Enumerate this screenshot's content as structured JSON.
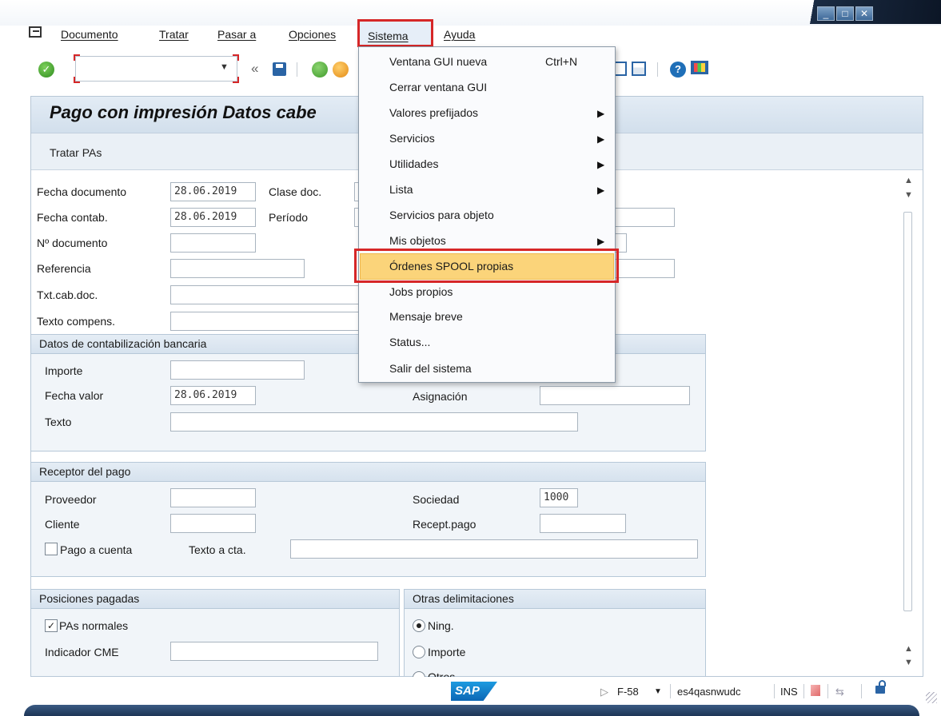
{
  "menubar": {
    "items": [
      "Documento",
      "Tratar",
      "Pasar a",
      "Opciones",
      "Sistema",
      "Ayuda"
    ]
  },
  "toolbar": {
    "back_glyph": "«"
  },
  "title": "Pago con impresión Datos cabe",
  "app_toolbar": {
    "button": "Tratar PAs"
  },
  "header_fields": {
    "fecha_documento": {
      "label": "Fecha documento",
      "value": "28.06.2019"
    },
    "clase_doc": {
      "label": "Clase doc.",
      "value": ""
    },
    "fecha_contab": {
      "label": "Fecha contab.",
      "value": "28.06.2019"
    },
    "periodo": {
      "label": "Período",
      "value": ""
    },
    "no_documento": {
      "label": "Nº documento",
      "value": ""
    },
    "referencia": {
      "label": "Referencia",
      "value": ""
    },
    "txt_cab_doc": {
      "label": "Txt.cab.doc.",
      "value": ""
    },
    "texto_compens": {
      "label": "Texto compens.",
      "value": ""
    }
  },
  "bank_group": {
    "title": "Datos de contabilización bancaria",
    "importe": {
      "label": "Importe",
      "value": ""
    },
    "fecha_valor": {
      "label": "Fecha valor",
      "value": "28.06.2019"
    },
    "asignacion": {
      "label": "Asignación",
      "value": ""
    },
    "texto": {
      "label": "Texto",
      "value": ""
    }
  },
  "payee_group": {
    "title": "Receptor del pago",
    "proveedor": {
      "label": "Proveedor",
      "value": ""
    },
    "sociedad": {
      "label": "Sociedad",
      "value": "1000"
    },
    "cliente": {
      "label": "Cliente",
      "value": ""
    },
    "recept_pago": {
      "label": "Recept.pago",
      "value": ""
    },
    "pago_a_cuenta": {
      "label": "Pago a cuenta",
      "checked": false
    },
    "texto_a_cta": {
      "label": "Texto a cta.",
      "value": ""
    }
  },
  "paid_items_group": {
    "title": "Posiciones pagadas",
    "pas_normales": {
      "label": "PAs normales",
      "checked": true
    },
    "indicador_cme": {
      "label": "Indicador CME",
      "value": ""
    }
  },
  "other_group": {
    "title": "Otras delimitaciones",
    "options": [
      "Ning.",
      "Importe",
      "Otros"
    ],
    "selected": "Ning."
  },
  "sistema_menu": {
    "items": [
      {
        "label": "Ventana GUI nueva",
        "shortcut": "Ctrl+N",
        "submenu": false
      },
      {
        "label": "Cerrar ventana GUI",
        "submenu": false
      },
      {
        "label": "Valores prefijados",
        "submenu": true
      },
      {
        "label": "Servicios",
        "submenu": true
      },
      {
        "label": "Utilidades",
        "submenu": true
      },
      {
        "label": "Lista",
        "submenu": true
      },
      {
        "label": "Servicios para objeto",
        "submenu": false
      },
      {
        "label": "Mis objetos",
        "submenu": true
      },
      {
        "label": "Órdenes SPOOL propias",
        "submenu": false,
        "highlighted": true
      },
      {
        "label": "Jobs propios",
        "submenu": false
      },
      {
        "label": "Mensaje breve",
        "submenu": false
      },
      {
        "label": "Status...",
        "submenu": false
      },
      {
        "label": "Salir del sistema",
        "submenu": false
      }
    ]
  },
  "status_bar": {
    "logo": "SAP",
    "transaction": "F-58",
    "server": "es4qasnwudc",
    "mode": "INS"
  },
  "colors": {
    "highlight": "#fbd47a",
    "annotation_red": "#d62728",
    "header_blue": "#d2dfec"
  }
}
